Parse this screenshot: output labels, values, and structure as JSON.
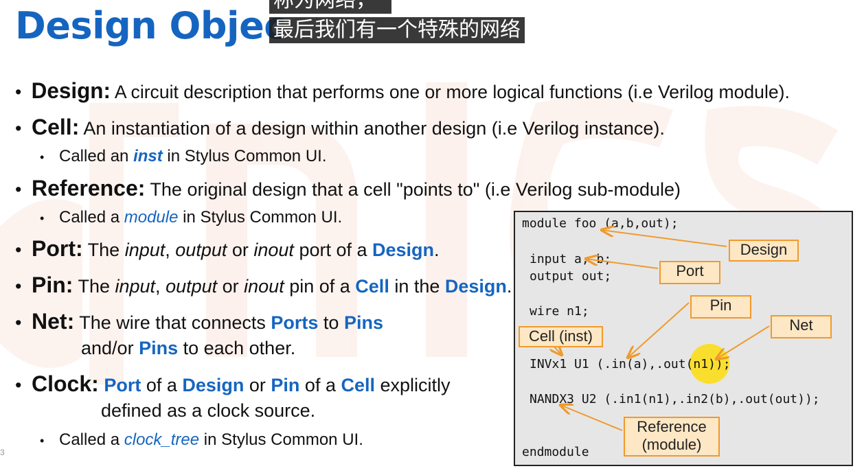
{
  "title": "Design Objec",
  "subtitle": {
    "line1": "称为网络，",
    "line2": "最后我们有一个特殊的网络"
  },
  "bullets": [
    {
      "term": "Design:",
      "text": "A circuit description that performs one or more logical functions (i.e Verilog module)."
    },
    {
      "term": "Cell:",
      "text": "An instantiation of a design within another design (i.e Verilog instance)."
    },
    {
      "term": "Reference:",
      "text": "The original design that a cell \"points to\" (i.e Verilog sub-module)"
    },
    {
      "term": "Port:",
      "t1": "The ",
      "i1": "input",
      "t2": ", ",
      "i2": "output",
      "t3": " or ",
      "i3": "inout",
      "t4": " port of a ",
      "b1": "Design",
      "t5": "."
    },
    {
      "term": "Pin:",
      "t1": "The ",
      "i1": "input",
      "t2": ", ",
      "i2": "output",
      "t3": " or ",
      "i3": "inout",
      "t4": " pin of a ",
      "b1": "Cell",
      "t5": " in the ",
      "b2": "Design",
      "t6": "."
    },
    {
      "term": "Net:",
      "t1": "The wire that connects ",
      "b1": "Ports",
      "t2": " to ",
      "b2": "Pins",
      "c1": "and/or ",
      "cb1": "Pins",
      "c2": " to each other."
    },
    {
      "term": "Clock:",
      "b1": "Port",
      "t1": " of a ",
      "b2": "Design",
      "t2": " or ",
      "b3": "Pin",
      "t3": " of a ",
      "b4": "Cell",
      "t4": " explicitly",
      "c1": "defined as a clock source."
    }
  ],
  "subbullets": [
    {
      "pre": "Called an ",
      "em": "inst",
      "post": " in Stylus Common UI."
    },
    {
      "pre": "Called a ",
      "em": "module",
      "post": " in Stylus Common UI."
    },
    {
      "pre": "Called a ",
      "em": "clock_tree",
      "post": " in Stylus Common UI."
    }
  ],
  "code": {
    "l1": "module foo (a,b,out);",
    "l2": "input a, b;",
    "l3": "output out;",
    "l4": "wire n1;",
    "l5": "INVx1 U1 (.in(a),.out(n1));",
    "l6": "NANDX3 U2 (.in1(n1),.in2(b),.out(out));",
    "l7": "endmodule"
  },
  "labels": {
    "design": "Design",
    "port": "Port",
    "pin": "Pin",
    "net": "Net",
    "cell": "Cell (inst)",
    "ref1": "Reference",
    "ref2": "(module)"
  },
  "page_number": "3",
  "colors": {
    "accent": "#1565c0",
    "label_border": "#f09a2c",
    "label_fill": "#fde7c4",
    "highlight": "#ffdc00"
  }
}
